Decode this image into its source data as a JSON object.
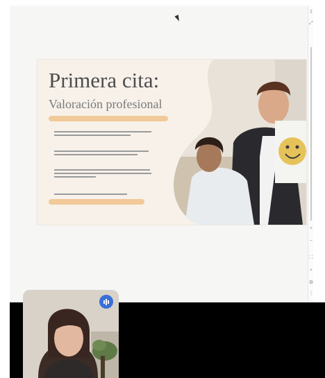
{
  "slide": {
    "title": "Primera cita:",
    "subtitle": "Valoración profesional"
  },
  "toolbar": {
    "icons": [
      "download-icon",
      "expand-icon",
      "add-icon",
      "remove-icon",
      "fit-icon",
      "search-icon",
      "settings-icon",
      "more-icon"
    ]
  },
  "colors": {
    "highlight": "#f2c998",
    "slide_bg": "#f7f1ea",
    "title": "#4d4d4d",
    "call_bg": "#000000",
    "badge": "#3b6fd8"
  }
}
